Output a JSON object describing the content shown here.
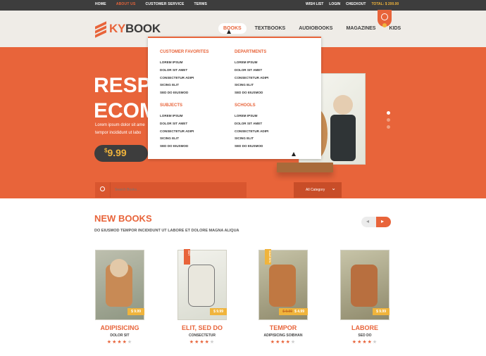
{
  "topbar": {
    "links": [
      "HOME",
      "ABOUT US",
      "CUSTOMER SERVICE",
      "TERMS"
    ],
    "right_links": [
      "WISH LIST",
      "LOGIN",
      "CHECKOUT"
    ],
    "total": "TOTAL: $ 200.00"
  },
  "header": {
    "logo_prefix": "KY",
    "logo_suffix": "BOOK",
    "nav": [
      "BOOKS",
      "TEXTBOOKS",
      "AUDIOBOOKS",
      "MAGAZINES",
      "KIDS"
    ]
  },
  "hero": {
    "title_line1": "RESPO",
    "title_line2": "ECOME",
    "text_line1": "Lorem ipsum dolor sit ame",
    "text_line2": "tempor incididunt ut labo",
    "price": "9.99",
    "price_currency": "$"
  },
  "search": {
    "placeholder": "Search Books...",
    "category": "All Category"
  },
  "mega": {
    "col1": [
      {
        "title": "CUSTOMER FAVORITES",
        "items": [
          "LOREM IPSUM",
          "DOLOR SIT AMET",
          "CONSECTETUR ADIPI",
          "SICING ELIT",
          "SED DO EIUSMOD"
        ]
      },
      {
        "title": "SUBJECTS",
        "items": [
          "LOREM IPSUM",
          "DOLOR SIT AMET",
          "CONSECTETUR ADIPI",
          "SICING ELIT",
          "SED DO EIUSMOD"
        ]
      }
    ],
    "col2": [
      {
        "title": "DEPARTMENTS",
        "items": [
          "LOREM IPSUM",
          "DOLOR SIT AMET",
          "CONSECTETUR ADIPI",
          "SICING ELIT",
          "SED DO EIUSMOD"
        ]
      },
      {
        "title": "SCHOOLS",
        "items": [
          "LOREM IPSUM",
          "DOLOR SIT AMET",
          "CONSECTETUR ADIPI",
          "SICING ELIT",
          "SED DO EIUSMOD"
        ]
      }
    ]
  },
  "newbooks": {
    "title": "NEW BOOKS",
    "subtitle": "DO EIUSMOD TEMPOR INCIDIDUNT UT LABORE ET DOLORE MAGNA ALIQUA"
  },
  "books": [
    {
      "title": "ADIPISICING",
      "author": "DOLOR SIT",
      "price": "$ 9.99",
      "old_price": "",
      "rating": 4,
      "ribbon": ""
    },
    {
      "title": "ELIT, SED DO",
      "author": "CONSECTETUR",
      "price": "$ 9.99",
      "old_price": "",
      "rating": 4,
      "ribbon": "HOT"
    },
    {
      "title": "TEMPOR",
      "author": "ADIPISICING SOIBHAN",
      "price": "$ 4.99",
      "old_price": "$ 9.99",
      "rating": 4,
      "ribbon": "SALE 50%"
    },
    {
      "title": "LABORE",
      "author": "SED DO",
      "price": "$ 9.99",
      "old_price": "",
      "rating": 4,
      "ribbon": ""
    }
  ],
  "colors": {
    "accent": "#e8643a",
    "dark": "#3d3d3d",
    "gold": "#f0b43c"
  }
}
